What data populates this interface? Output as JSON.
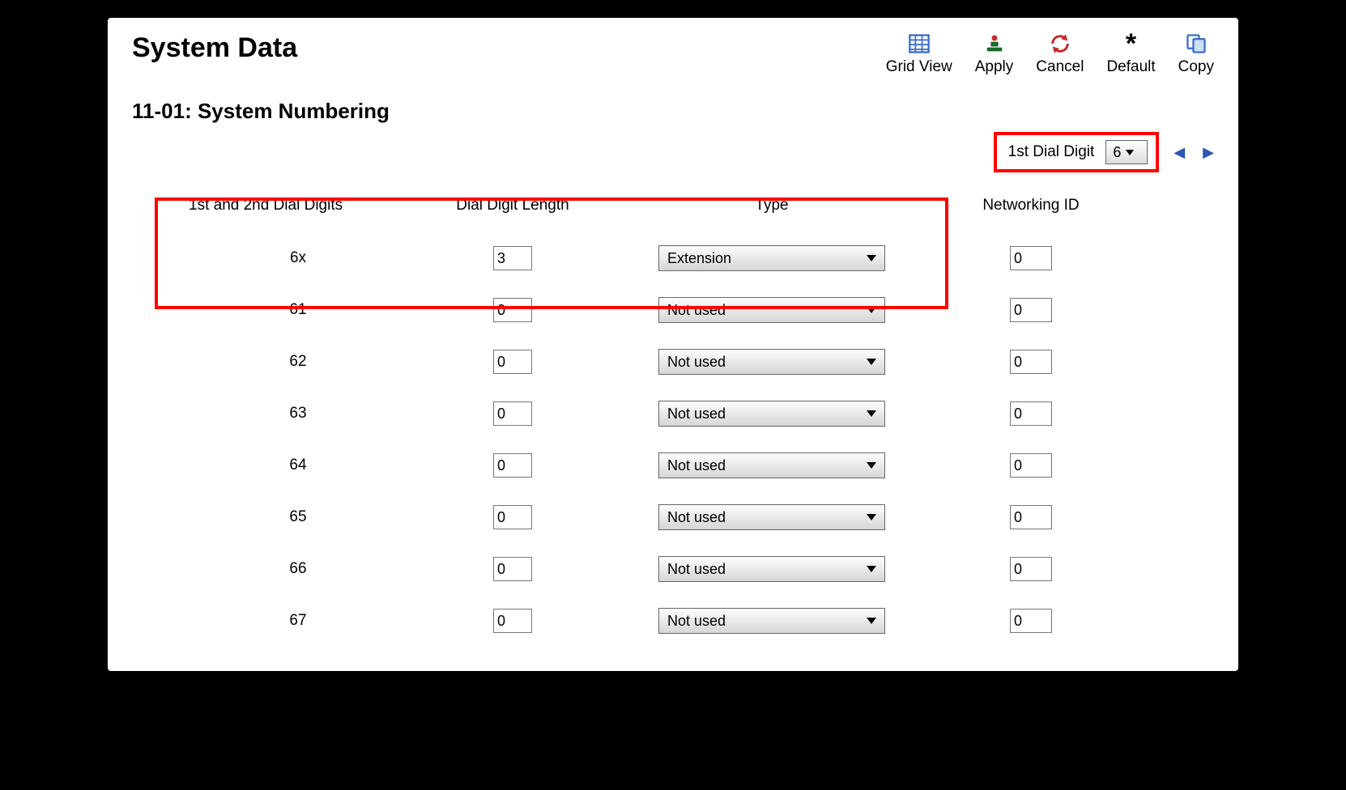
{
  "page_title": "System Data",
  "subtitle": "11-01: System Numbering",
  "toolbar": {
    "grid_view": "Grid View",
    "apply": "Apply",
    "cancel": "Cancel",
    "default": "Default",
    "copy": "Copy"
  },
  "dial_select": {
    "label": "1st Dial Digit",
    "value": "6"
  },
  "columns": {
    "digits": "1st and 2nd Dial Digits",
    "len": "Dial Digit Length",
    "type": "Type",
    "netid": "Networking ID"
  },
  "rows": [
    {
      "digits": "6x",
      "len": "3",
      "type": "Extension",
      "netid": "0"
    },
    {
      "digits": "61",
      "len": "0",
      "type": "Not used",
      "netid": "0"
    },
    {
      "digits": "62",
      "len": "0",
      "type": "Not used",
      "netid": "0"
    },
    {
      "digits": "63",
      "len": "0",
      "type": "Not used",
      "netid": "0"
    },
    {
      "digits": "64",
      "len": "0",
      "type": "Not used",
      "netid": "0"
    },
    {
      "digits": "65",
      "len": "0",
      "type": "Not used",
      "netid": "0"
    },
    {
      "digits": "66",
      "len": "0",
      "type": "Not used",
      "netid": "0"
    },
    {
      "digits": "67",
      "len": "0",
      "type": "Not used",
      "netid": "0"
    }
  ]
}
